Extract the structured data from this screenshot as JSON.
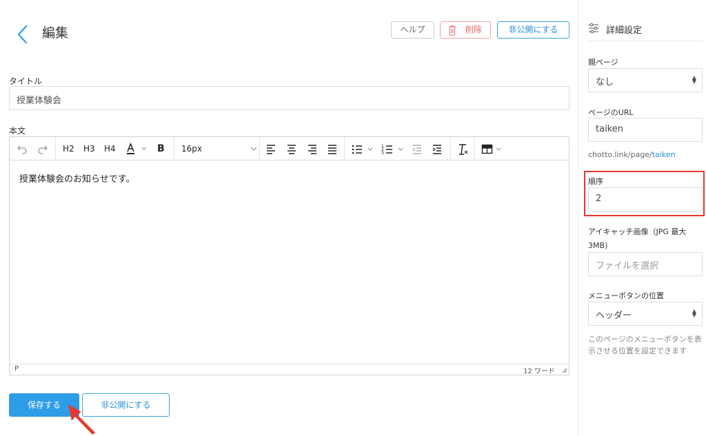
{
  "header": {
    "title": "編集",
    "help_label": "ヘルプ",
    "delete_label": "削除",
    "unpublish_label": "非公開にする"
  },
  "form": {
    "title_label": "タイトル",
    "title_value": "授業体験会",
    "body_label": "本文"
  },
  "editor": {
    "toolbar": {
      "h2": "H2",
      "h3": "H3",
      "h4": "H4",
      "bold": "B",
      "font_size": "16px"
    },
    "content": "授業体験会のお知らせです。",
    "status_path": "P",
    "word_count": "12 ワード"
  },
  "footer": {
    "save_label": "保存する",
    "unpublish_label": "非公開にする"
  },
  "sidebar": {
    "title": "詳細設定",
    "parent_label": "親ページ",
    "parent_value": "なし",
    "url_label": "ページのURL",
    "url_value": "taiken",
    "url_prefix": "chotto.link/page/",
    "url_slug": "taiken",
    "order_label": "順序",
    "order_value": "2",
    "eyecatch_label": "アイキャッチ画像（JPG 最大3MB)",
    "file_button": "ファイルを選択",
    "menu_pos_label": "メニューボタンの位置",
    "menu_pos_value": "ヘッダー",
    "menu_pos_note": "このページのメニューボタンを表示させる位置を設定できます"
  },
  "colors": {
    "accent": "#2d9de7",
    "danger": "#e56a6a",
    "highlight": "#e8382d"
  }
}
